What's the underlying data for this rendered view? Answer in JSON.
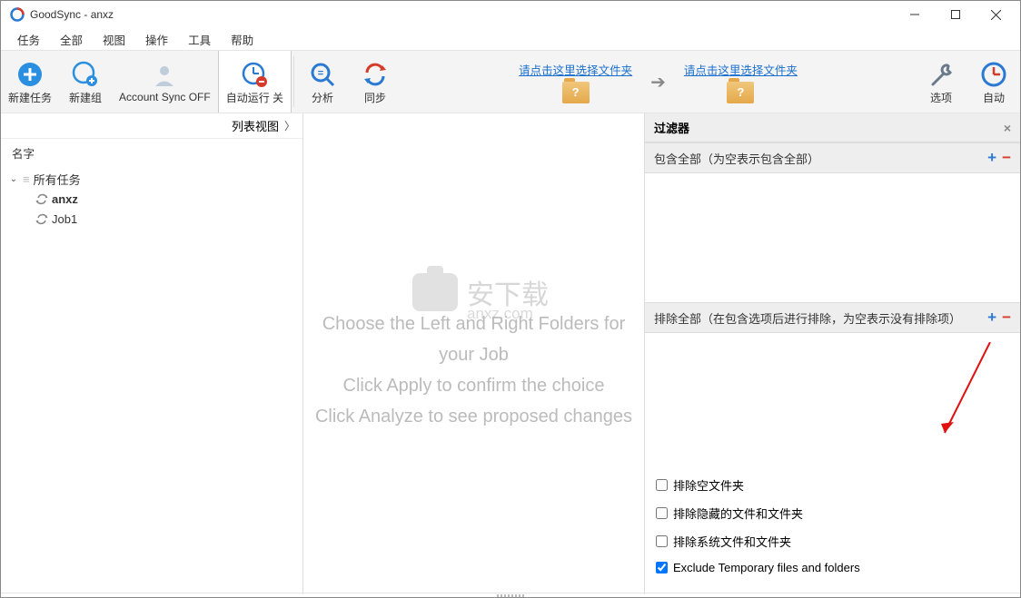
{
  "window": {
    "title": "GoodSync - anxz"
  },
  "menu": {
    "tasks": "任务",
    "all": "全部",
    "view": "视图",
    "operate": "操作",
    "tools": "工具",
    "help": "帮助"
  },
  "toolbar": {
    "newtask": "新建任务",
    "newgroup": "新建组",
    "account": "Account Sync OFF",
    "autorun": "自动运行 关",
    "analyze": "分析",
    "sync": "同步",
    "options": "选项",
    "auto": "自动",
    "leftFolder": "请点击这里选择文件夹",
    "rightFolder": "请点击这里选择文件夹"
  },
  "sidebar": {
    "viewmode": "列表视图",
    "colName": "名字",
    "root": "所有任务",
    "jobs": [
      {
        "name": "anxz",
        "bold": true
      },
      {
        "name": "Job1",
        "bold": false
      }
    ]
  },
  "center": {
    "line1": "Choose the Left and Right Folders for your Job",
    "line2": "Click Apply to confirm the choice",
    "line3": "Click Analyze to see proposed changes",
    "wm_text": "安下载",
    "wm_url": "anxz.com"
  },
  "filter": {
    "title": "过滤器",
    "include": "包含全部（为空表示包含全部）",
    "exclude": "排除全部（在包含选项后进行排除，为空表示没有排除项）",
    "checks": {
      "emptyFolders": "排除空文件夹",
      "hidden": "排除隐藏的文件和文件夹",
      "system": "排除系统文件和文件夹",
      "temp": "Exclude Temporary files and folders"
    }
  }
}
